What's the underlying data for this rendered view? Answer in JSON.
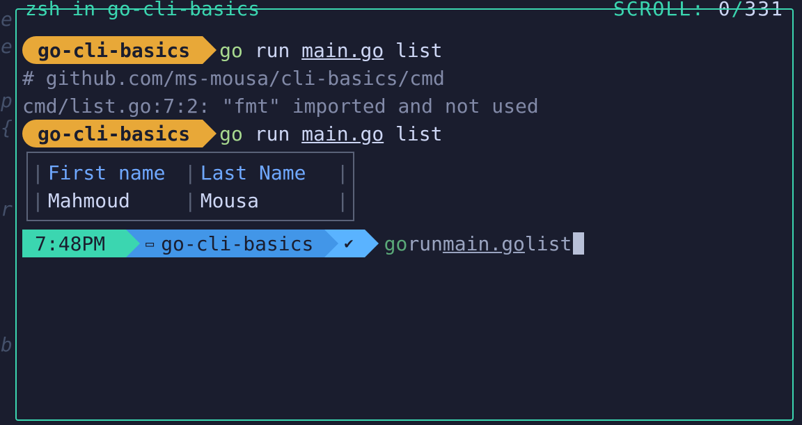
{
  "gutter": [
    "e",
    "e",
    "",
    "p",
    "{",
    "",
    "",
    "r",
    "",
    "",
    "",
    "",
    "b"
  ],
  "header": {
    "title": "zsh in go-cli-basics",
    "scroll_label": "SCROLL:",
    "scroll_pos": "0",
    "scroll_sep": "/",
    "scroll_total": "331"
  },
  "prompts": {
    "badge_label": "go-cli-basics",
    "cmd_go": "go",
    "cmd_run": "run",
    "cmd_file": "main.go",
    "cmd_arg": "list"
  },
  "output": {
    "pkg_comment": "# github.com/ms-mousa/cli-basics/cmd",
    "err_line": "cmd/list.go:7:2: \"fmt\" imported and not used"
  },
  "table": {
    "h1": "First name",
    "h2": "Last Name",
    "r1c1": "Mahmoud",
    "r1c2": "Mousa"
  },
  "powerline": {
    "time": "7:48PM",
    "dir": "go-cli-basics"
  }
}
